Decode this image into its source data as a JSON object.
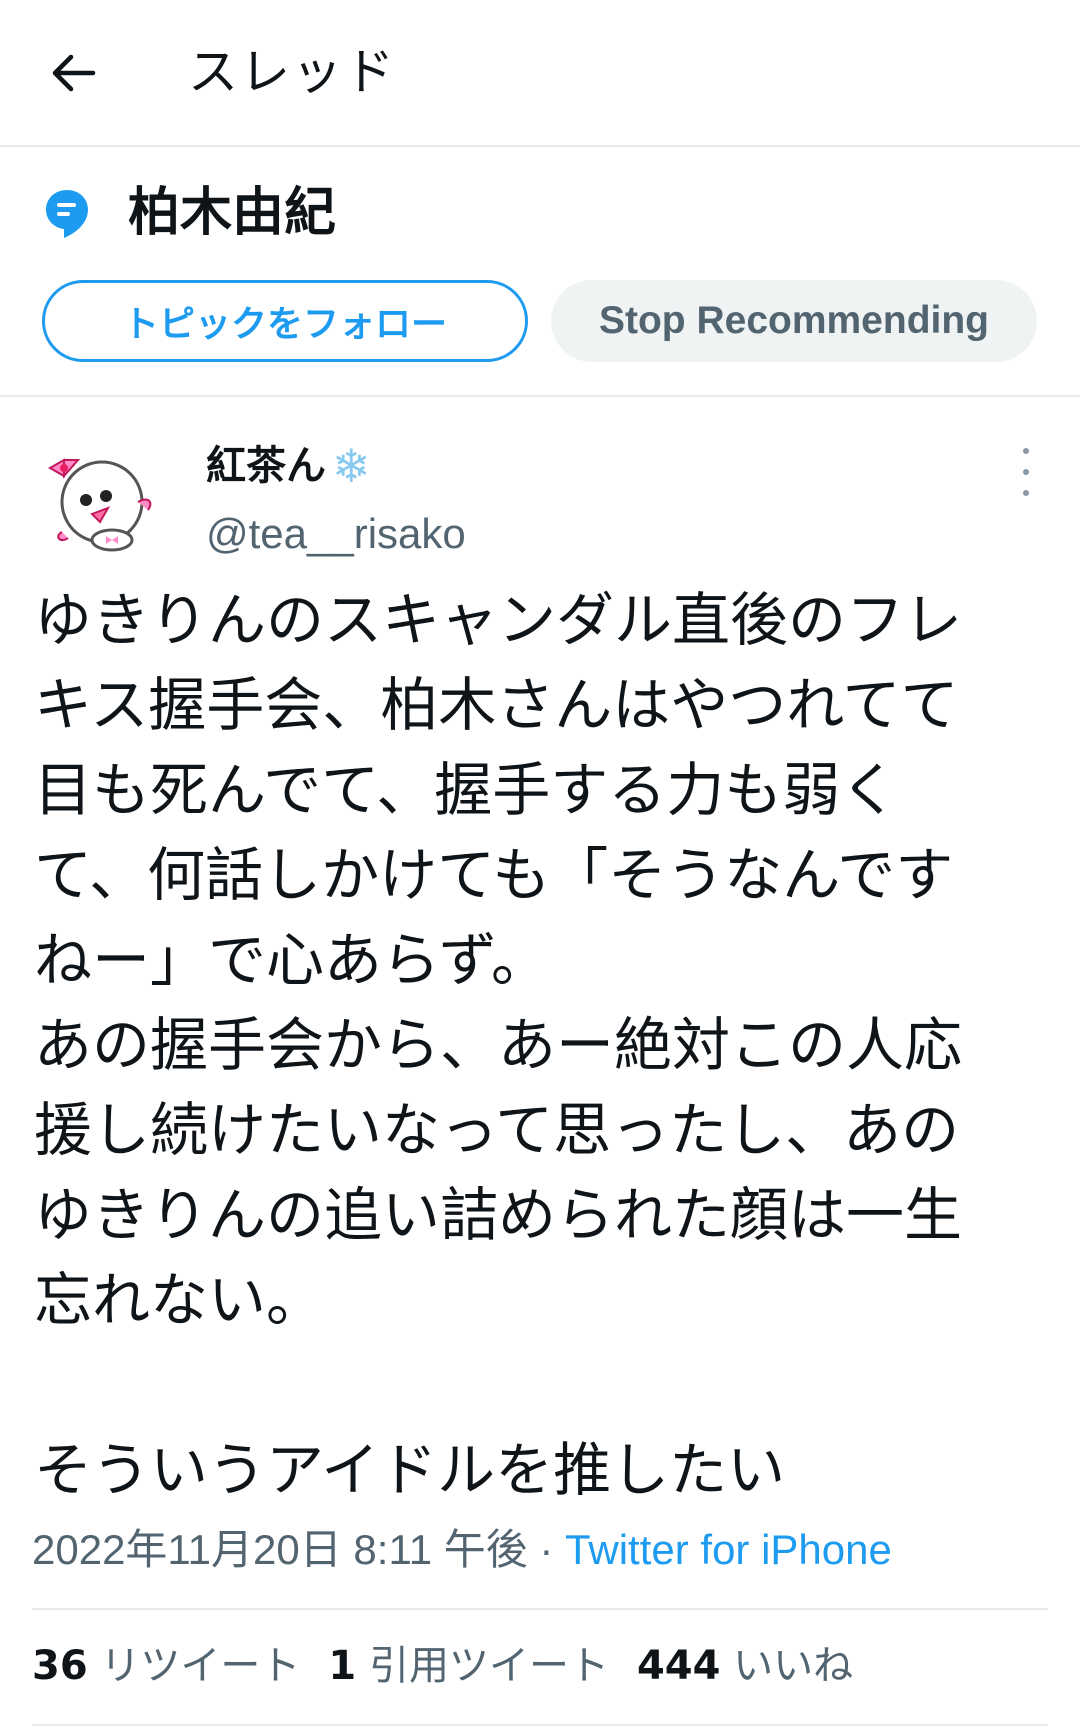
{
  "header": {
    "back_icon": "arrow-left-icon",
    "title": "スレッド"
  },
  "topic": {
    "icon": "topic-bubble-icon",
    "name": "柏木由紀",
    "follow_label": "トピックをフォロー",
    "stop_label": "Stop Recommending",
    "accent_color": "#1d9bf0"
  },
  "tweet": {
    "avatar_icon": "cartoon-mascot-avatar",
    "display_name": "紅茶ん",
    "name_emoji": "❄",
    "handle": "@tea__risako",
    "more_icon": "more-vertical-icon",
    "lines": [
      "ゆきりんのスキャンダル直後のフレ",
      "キス握手会、柏木さんはやつれてて",
      "目も死んでて、握手する力も弱く",
      "て、何話しかけても「そうなんです",
      "ねー」で心あらず。",
      "あの握手会から、あー絶対この人応",
      "援し続けたいなって思ったし、あの",
      "ゆきりんの追い詰められた顔は一生",
      "忘れない。",
      "",
      "そういうアイドルを推したい"
    ],
    "timestamp": "2022年11月20日 8:11 午後",
    "separator": " · ",
    "source": "Twitter for iPhone",
    "stats": {
      "retweets_count": "36",
      "retweets_label": "リツイート",
      "quotes_count": "1",
      "quotes_label": "引用ツイート",
      "likes_count": "444",
      "likes_label": "いいね"
    }
  }
}
